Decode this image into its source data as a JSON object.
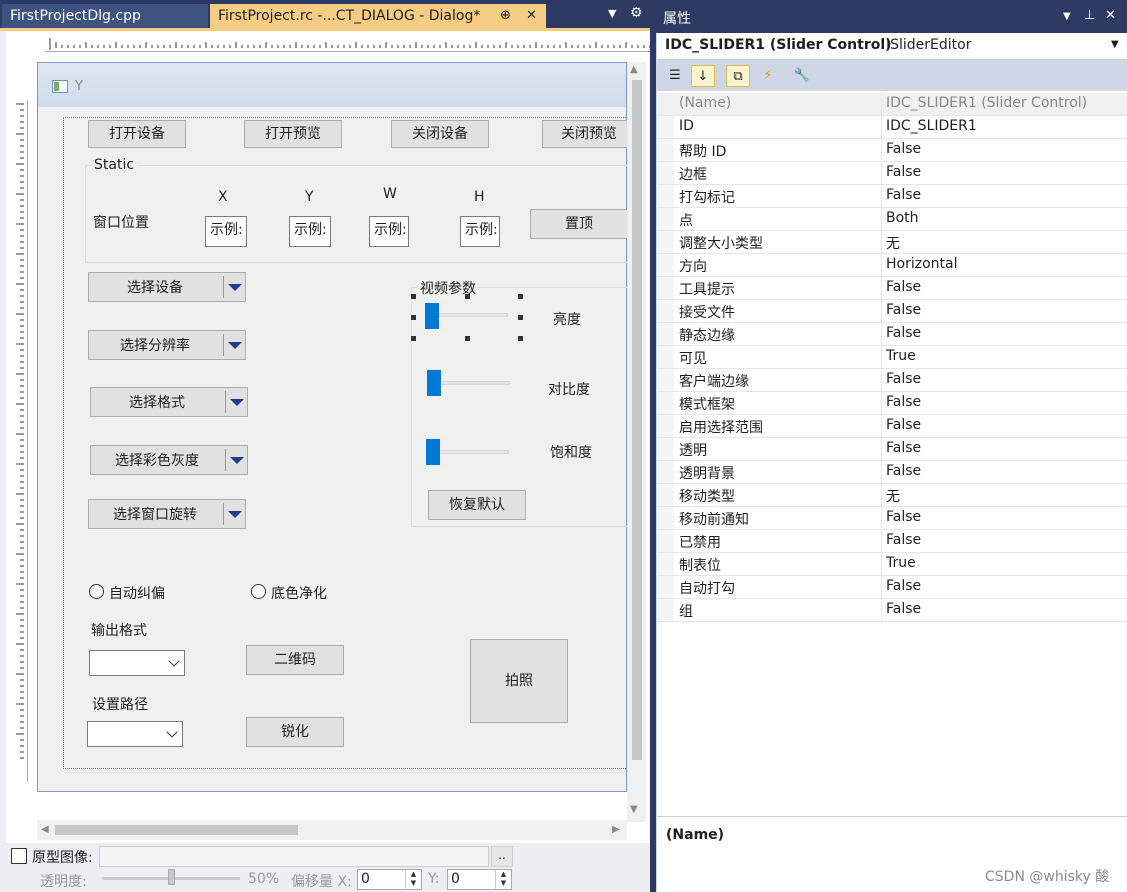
{
  "tabs": {
    "tab1_label": "FirstProjectDlg.cpp",
    "tab2_label": "FirstProject.rc -...CT_DIALOG - Dialog*",
    "tab2_pin": "⊕",
    "tab2_close": "✕"
  },
  "dialog": {
    "title": "Y",
    "buttons": {
      "open_device": "打开设备",
      "open_preview": "打开预览",
      "close_device": "关闭设备",
      "close_preview": "关闭预览",
      "topmost": "置顶",
      "restore_default": "恢复默认",
      "qrcode": "二维码",
      "sharpen": "锐化",
      "capture": "拍照"
    },
    "group_static": "Static",
    "window_pos_label": "窗口位置",
    "coord_labels": [
      "X",
      "Y",
      "W",
      "H"
    ],
    "edit_text": [
      "示例:",
      "示例:",
      "示例:",
      "示例:"
    ],
    "combos": [
      "选择设备",
      "选择分辨率",
      "选择格式",
      "选择彩色灰度",
      "选择窗口旋转"
    ],
    "video_group": "视频参数",
    "slider_labels": [
      "亮度",
      "对比度",
      "饱和度"
    ],
    "radios": [
      "自动纠偏",
      "底色净化"
    ],
    "output_format_label": "输出格式",
    "set_path_label": "设置路径"
  },
  "bottom": {
    "prototype_label": "原型图像:",
    "browse": "..",
    "opacity_label": "透明度:",
    "opacity_value": "50%",
    "offset_label": "偏移量 X:",
    "offset_x": "0",
    "offset_y_label": "Y:",
    "offset_y": "0"
  },
  "properties": {
    "panel_title": "属性",
    "object_name": "IDC_SLIDER1 (Slider Control)",
    "object_type": "ISliderEditor",
    "rows": [
      {
        "name": "(Name)",
        "value": "IDC_SLIDER1 (Slider Control)"
      },
      {
        "name": "ID",
        "value": "IDC_SLIDER1"
      },
      {
        "name": "帮助 ID",
        "value": "False"
      },
      {
        "name": "边框",
        "value": "False"
      },
      {
        "name": "打勾标记",
        "value": "False"
      },
      {
        "name": "点",
        "value": "Both"
      },
      {
        "name": "调整大小类型",
        "value": "无"
      },
      {
        "name": "方向",
        "value": "Horizontal"
      },
      {
        "name": "工具提示",
        "value": "False"
      },
      {
        "name": "接受文件",
        "value": "False"
      },
      {
        "name": "静态边缘",
        "value": "False"
      },
      {
        "name": "可见",
        "value": "True"
      },
      {
        "name": "客户端边缘",
        "value": "False"
      },
      {
        "name": "模式框架",
        "value": "False"
      },
      {
        "name": "启用选择范围",
        "value": "False"
      },
      {
        "name": "透明",
        "value": "False"
      },
      {
        "name": "透明背景",
        "value": "False"
      },
      {
        "name": "移动类型",
        "value": "无"
      },
      {
        "name": "移动前通知",
        "value": "False"
      },
      {
        "name": "已禁用",
        "value": "False"
      },
      {
        "name": "制表位",
        "value": "True"
      },
      {
        "name": "自动打勾",
        "value": "False"
      },
      {
        "name": "组",
        "value": "False"
      }
    ],
    "description_title": "(Name)",
    "watermark": "CSDN @whisky 酸"
  },
  "colors": {
    "accent_tab": "#f5cc84",
    "chrome": "#2d3a64",
    "slider_thumb": "#0078d7"
  }
}
